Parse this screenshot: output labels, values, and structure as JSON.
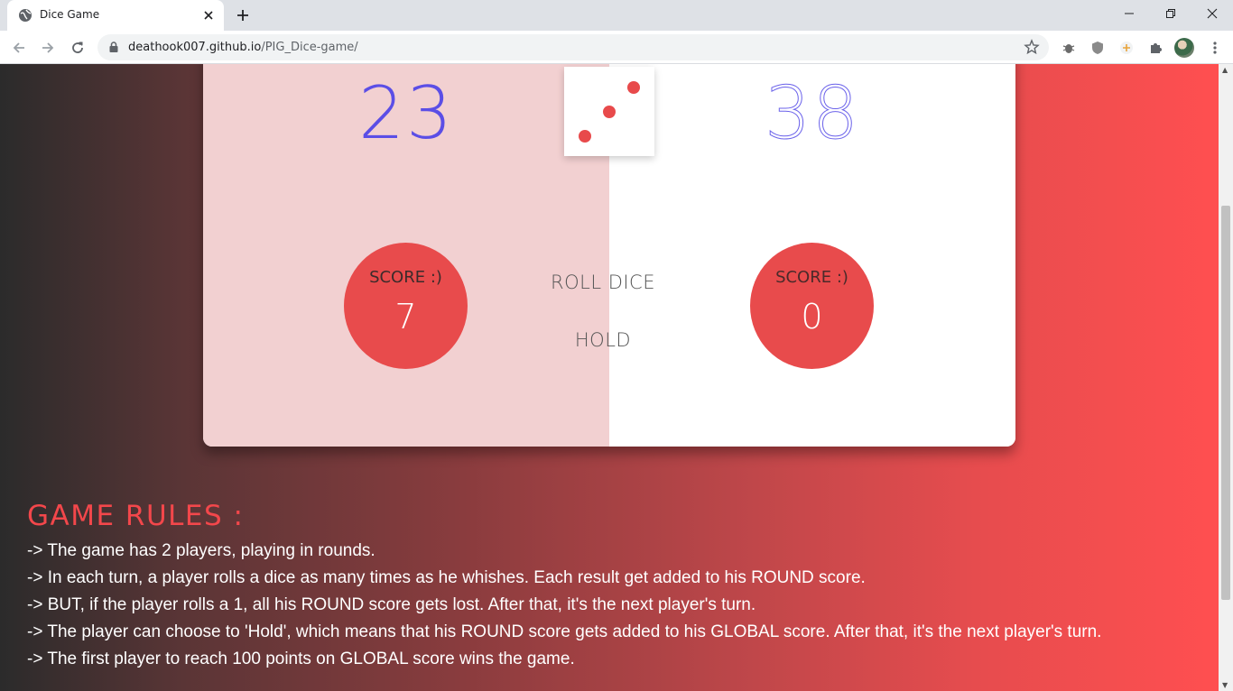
{
  "browser": {
    "tab_title": "Dice Game",
    "url_host": "deathook007.github.io",
    "url_path": "/PIG_Dice-game/"
  },
  "game": {
    "player1": {
      "global_score": "23",
      "round_label": "SCORE :)",
      "round_score": "7"
    },
    "player2": {
      "global_score": "38",
      "round_label": "SCORE :)",
      "round_score": "0"
    },
    "dice_value": 3,
    "roll_label": "ROLL DICE",
    "hold_label": "HOLD",
    "active_player": 1
  },
  "rules": {
    "title": "GAME RULES :",
    "items": [
      "-> The game has 2 players, playing in rounds.",
      "-> In each turn, a player rolls a dice as many times as he whishes. Each result get added to his ROUND score.",
      "-> BUT, if the player rolls a 1, all his ROUND score gets lost. After that, it's the next player's turn.",
      "-> The player can choose to 'Hold', which means that his ROUND score gets added to his GLOBAL score. After that, it's the next player's turn.",
      "-> The first player to reach 100 points on GLOBAL score wins the game."
    ]
  },
  "colors": {
    "accent": "#e84b4c",
    "score_text": "#5b4ee6",
    "active_panel": "#f2d0d1"
  },
  "icons": [
    "globe-icon",
    "close-icon",
    "plus-icon",
    "back-icon",
    "forward-icon",
    "reload-icon",
    "lock-icon",
    "star-icon",
    "bug-icon",
    "shield-icon",
    "puzzle-icon",
    "menu-icon"
  ]
}
